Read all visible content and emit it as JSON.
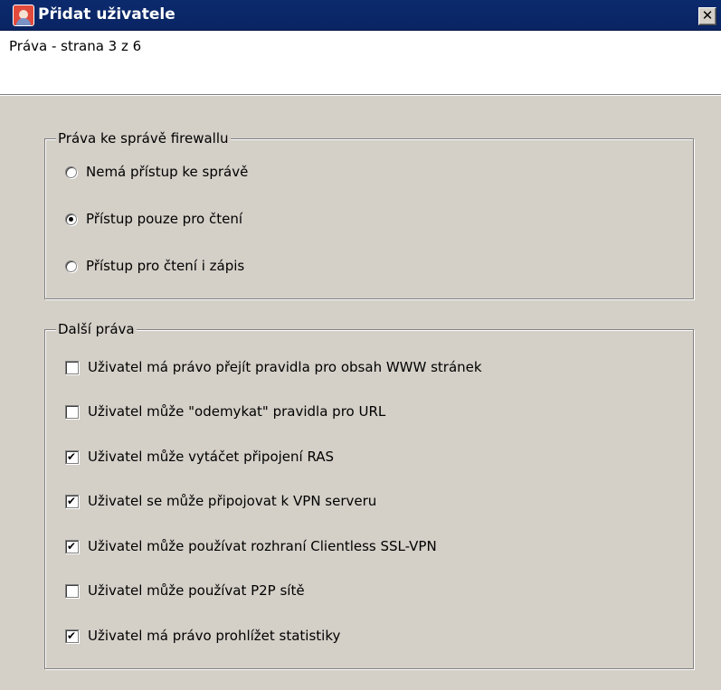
{
  "window": {
    "title": "Přidat uživatele",
    "close_glyph": "✕",
    "icon": "add-user-app-icon"
  },
  "header": {
    "subtitle": "Práva - strana 3 z 6"
  },
  "firewall_group": {
    "legend": "Práva ke správě firewallu",
    "options": [
      {
        "label": "Nemá přístup ke správě",
        "selected": false
      },
      {
        "label": "Přístup pouze pro čtení",
        "selected": true
      },
      {
        "label": "Přístup pro čtení i zápis",
        "selected": false
      }
    ]
  },
  "other_group": {
    "legend": "Další práva",
    "items": [
      {
        "label": "Uživatel má právo přejít pravidla pro obsah WWW stránek",
        "checked": false
      },
      {
        "label": "Uživatel může \"odemykat\" pravidla pro URL",
        "checked": false
      },
      {
        "label": "Uživatel může vytáčet připojení RAS",
        "checked": true
      },
      {
        "label": "Uživatel se může připojovat k VPN serveru",
        "checked": true
      },
      {
        "label": "Uživatel může používat rozhraní Clientless SSL-VPN",
        "checked": true
      },
      {
        "label": "Uživatel může používat P2P sítě",
        "checked": false
      },
      {
        "label": "Uživatel má právo prohlížet statistiky",
        "checked": true
      }
    ]
  }
}
